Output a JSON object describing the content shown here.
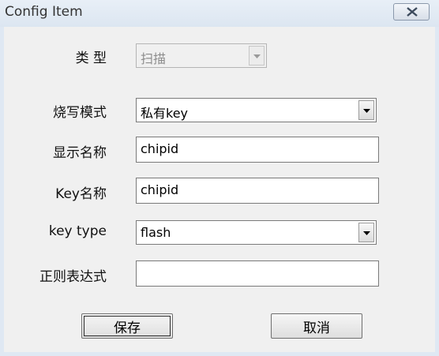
{
  "window": {
    "title": "Config Item"
  },
  "fields": [
    {
      "label": "类 型",
      "value": "扫描",
      "kind": "combo-disabled"
    },
    {
      "label": "烧写模式",
      "value": "私有key",
      "kind": "combo"
    },
    {
      "label": "显示名称",
      "value": "chipid",
      "kind": "text"
    },
    {
      "label": "Key名称",
      "value": "chipid",
      "kind": "text"
    },
    {
      "label": "key type",
      "value": "flash",
      "kind": "combo"
    },
    {
      "label": "正则表达式",
      "value": "",
      "kind": "text"
    }
  ],
  "buttons": {
    "save": "保存",
    "cancel": "取消"
  },
  "icons": {
    "close": "close-icon",
    "dropdown": "chevron-down-icon"
  }
}
